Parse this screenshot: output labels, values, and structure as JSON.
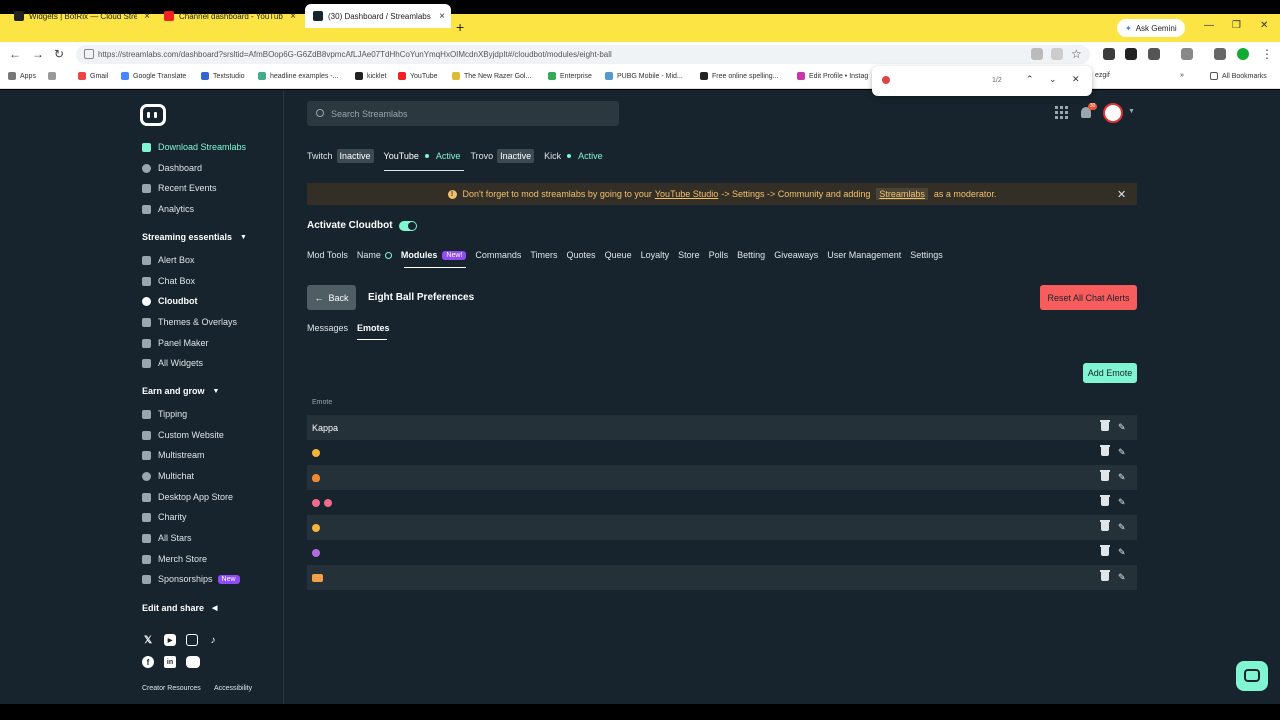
{
  "browser": {
    "tabs": [
      {
        "label": "Widgets | BotRix — Cloud Strea",
        "active": false
      },
      {
        "label": "Channel dashboard - YouTube",
        "active": false
      },
      {
        "label": "(30) Dashboard / Streamlabs",
        "active": true
      }
    ],
    "ask_gemini": "Ask Gemini",
    "url": "https://streamlabs.com/dashboard?srsltid=AfmBOop6G-G6ZdB8vpmcAfLJAe07TdHhCoYunYmqHxOIMcdnXByjdpIt#/cloudbot/modules/eight-ball",
    "bookmarks": [
      "Apps",
      "Gmail",
      "Google Translate",
      "Textstudio",
      "headline examples -...",
      "kicklet",
      "YouTube",
      "The New Razer Gol...",
      "Enterprise",
      "PUBG Mobile - Mid...",
      "Free online spelling...",
      "Edit Profile • Instag",
      "ezgif"
    ],
    "all_bookmarks": "All Bookmarks",
    "find": {
      "count": "1/2"
    }
  },
  "sidebar": {
    "download": "Download Streamlabs",
    "main_items": [
      "Dashboard",
      "Recent Events",
      "Analytics"
    ],
    "section1": {
      "title": "Streaming essentials",
      "items": [
        "Alert Box",
        "Chat Box",
        "Cloudbot",
        "Themes & Overlays",
        "Panel Maker",
        "All Widgets"
      ]
    },
    "section2": {
      "title": "Earn and grow",
      "items": [
        "Tipping",
        "Custom Website",
        "Multistream",
        "Multichat",
        "Desktop App Store",
        "Charity",
        "All Stars",
        "Merch Store",
        "Sponsorships"
      ]
    },
    "new_badge": "New",
    "section3": {
      "title": "Edit and share"
    },
    "footer": {
      "creator": "Creator Resources",
      "accessibility": "Accessibility"
    }
  },
  "header": {
    "search_placeholder": "Search Streamlabs",
    "notif_count": "30"
  },
  "platforms": [
    {
      "name": "Twitch",
      "status": "Inactive"
    },
    {
      "name": "YouTube",
      "status": "Active"
    },
    {
      "name": "Trovo",
      "status": "Inactive"
    },
    {
      "name": "Kick",
      "status": "Active"
    }
  ],
  "banner": {
    "pre": "Don't forget to mod streamlabs by going to your",
    "link": "YouTube Studio",
    "mid": "-> Settings -> Community and adding",
    "chip": "Streamlabs",
    "post": "as a moderator."
  },
  "activate_label": "Activate Cloudbot",
  "subnav": [
    "Mod Tools",
    "Name",
    "Modules",
    "Commands",
    "Timers",
    "Quotes",
    "Queue",
    "Loyalty",
    "Store",
    "Polls",
    "Betting",
    "Giveaways",
    "User Management",
    "Settings"
  ],
  "subnav_new": "New!",
  "back_label": "Back",
  "prefs_title": "Eight Ball Preferences",
  "reset_label": "Reset All Chat Alerts",
  "subtabs": [
    "Messages",
    "Emotes"
  ],
  "add_emote": "Add Emote",
  "table": {
    "column": "Emote",
    "rows": [
      "Kappa",
      "",
      "",
      "",
      "",
      "",
      ""
    ]
  },
  "colors": {
    "accent": "#80f5d2",
    "danger": "#f85d5d",
    "bg": "#17242d",
    "warn": "#f3c06b"
  }
}
